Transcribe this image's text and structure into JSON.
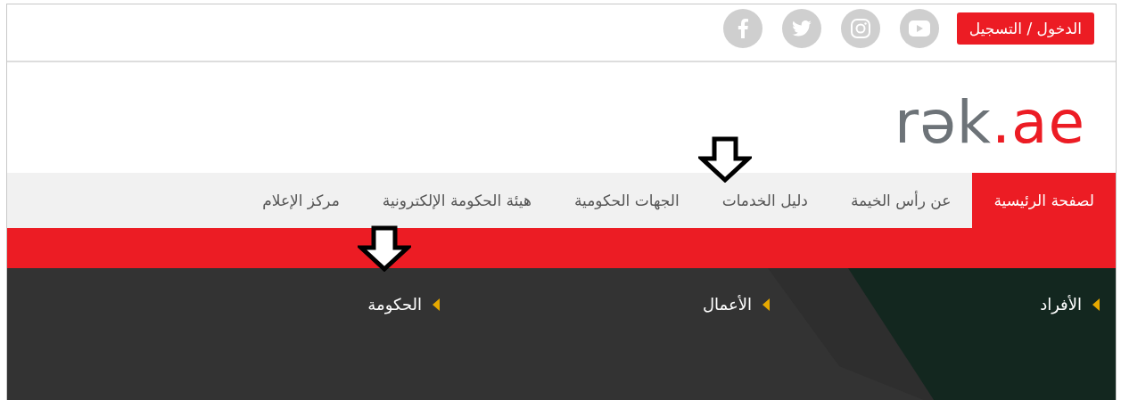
{
  "top_bar": {
    "login_button": "الدخول / التسجيل",
    "social": [
      {
        "kind": "youtube"
      },
      {
        "kind": "instagram"
      },
      {
        "kind": "twitter"
      },
      {
        "kind": "facebook"
      }
    ]
  },
  "logo": {
    "main": "rək",
    "accent": ".ae"
  },
  "nav": [
    {
      "label": "لصفحة الرئيسية",
      "selected": true
    },
    {
      "label": "عن رأس الخيمة",
      "selected": false
    },
    {
      "label": "دليل الخدمات",
      "selected": false
    },
    {
      "label": "الجهات الحكومية",
      "selected": false
    },
    {
      "label": "هيئة الحكومة الإلكترونية",
      "selected": false
    },
    {
      "label": "مركز الإعلام",
      "selected": false
    }
  ],
  "categories": [
    "الأفراد",
    "الأعمال",
    "الحكومة"
  ]
}
